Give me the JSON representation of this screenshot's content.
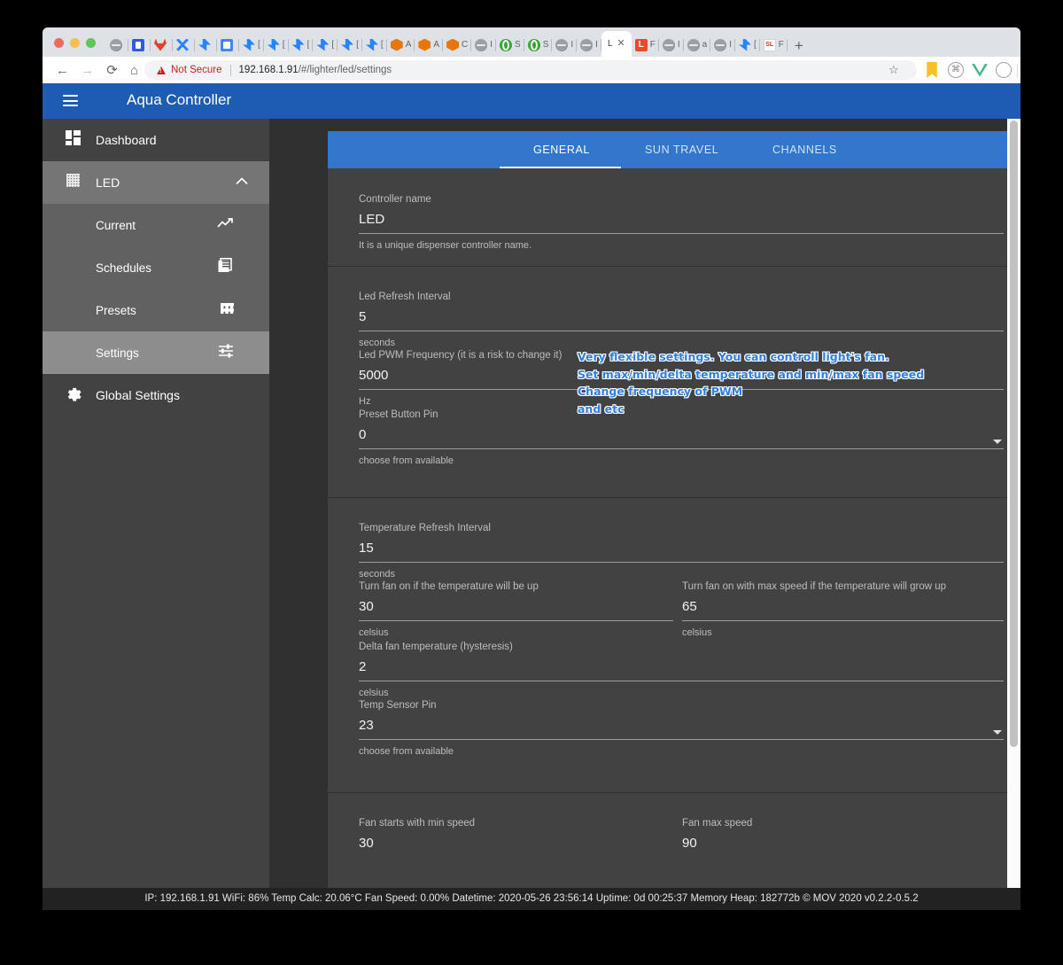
{
  "browser": {
    "url_prefix": "192.168.1.91",
    "url_rest": "/#/lighter/led/settings",
    "security_label": "Not Secure",
    "back_icon": "←",
    "forward_icon": "→",
    "reload_icon": "⟳",
    "home_icon": "⌂",
    "star_icon": "☆",
    "newtab_label": "+",
    "close_tab_label": "✕",
    "ext_cmd_glyph": "⌘",
    "ext_circ_glyph": "(..)",
    "profile_warning_glyph": "!",
    "tabs": [
      {
        "title": "",
        "favicon": "globe-icon",
        "active": false
      },
      {
        "title": "",
        "favicon": "blue-square-icon",
        "active": false
      },
      {
        "title": "",
        "favicon": "gitlab-icon",
        "active": false
      },
      {
        "title": "",
        "favicon": "x-icon",
        "active": false
      },
      {
        "title": "",
        "favicon": "jira-icon",
        "active": false
      },
      {
        "title": "",
        "favicon": "doc-icon",
        "active": false
      },
      {
        "title": "[",
        "favicon": "jira-icon",
        "active": false
      },
      {
        "title": "[",
        "favicon": "jira-icon",
        "active": false
      },
      {
        "title": "[",
        "favicon": "jira-icon",
        "active": false
      },
      {
        "title": "[",
        "favicon": "jira-icon",
        "active": false
      },
      {
        "title": "[",
        "favicon": "jira-icon",
        "active": false
      },
      {
        "title": "[",
        "favicon": "jira-icon",
        "active": false
      },
      {
        "title": "A",
        "favicon": "cube-icon",
        "active": false
      },
      {
        "title": "A",
        "favicon": "cube-icon",
        "active": false
      },
      {
        "title": "C",
        "favicon": "cube-icon",
        "active": false
      },
      {
        "title": "I",
        "favicon": "globe-icon",
        "active": false
      },
      {
        "title": "S",
        "favicon": "green-circle-icon",
        "active": false
      },
      {
        "title": "S",
        "favicon": "green-circle-icon",
        "active": false
      },
      {
        "title": "I",
        "favicon": "globe-icon",
        "active": false
      },
      {
        "title": "I",
        "favicon": "globe-icon",
        "active": false
      },
      {
        "title": "L",
        "favicon": "none",
        "active": true
      },
      {
        "title": "F",
        "favicon": "orange-l-icon",
        "active": false
      },
      {
        "title": "I",
        "favicon": "globe-icon",
        "active": false
      },
      {
        "title": "a",
        "favicon": "globe-icon",
        "active": false
      },
      {
        "title": "I",
        "favicon": "globe-icon",
        "active": false
      },
      {
        "title": "[",
        "favicon": "jira-icon",
        "active": false
      },
      {
        "title": "F",
        "favicon": "sl-icon",
        "active": false
      }
    ]
  },
  "app": {
    "title": "Aqua Controller",
    "menu_icon": "hamburger-icon"
  },
  "sidebar": {
    "items": [
      {
        "label": "Dashboard",
        "icon": "dashboard-icon",
        "selected": false
      },
      {
        "label": "LED",
        "icon": "grid-icon",
        "selected": true,
        "chevron": "˄"
      }
    ],
    "sub_items": [
      {
        "label": "Current",
        "icon": "trending-up-icon",
        "selected": false
      },
      {
        "label": "Schedules",
        "icon": "list-icon",
        "selected": false
      },
      {
        "label": "Presets",
        "icon": "apps-grid-icon",
        "selected": false
      },
      {
        "label": "Settings",
        "icon": "tune-icon",
        "selected": true
      }
    ],
    "global": {
      "label": "Global Settings",
      "icon": "gear-icon"
    }
  },
  "tabs": {
    "items": [
      {
        "label": "GENERAL",
        "active": true
      },
      {
        "label": "SUN TRAVEL",
        "active": false
      },
      {
        "label": "CHANNELS",
        "active": false
      }
    ]
  },
  "form": {
    "controller_name": {
      "label": "Controller name",
      "value": "LED",
      "hint": "It is a unique dispenser controller name."
    },
    "led_refresh_interval": {
      "label": "Led Refresh Interval",
      "value": "5",
      "hint": "seconds"
    },
    "led_pwm_frequency": {
      "label": "Led PWM Frequency (it is a risk to change it)",
      "value": "5000",
      "hint": "Hz"
    },
    "preset_button_pin": {
      "label": "Preset Button Pin",
      "value": "0",
      "hint": "choose from available"
    },
    "temperature_refresh_interval": {
      "label": "Temperature Refresh Interval",
      "value": "15",
      "hint": "seconds"
    },
    "fan_on_temp": {
      "label": "Turn fan on if the temperature will be up",
      "value": "30",
      "hint": "celsius"
    },
    "fan_max_temp": {
      "label": "Turn fan on with max speed if the temperature will grow up",
      "value": "65",
      "hint": "celsius"
    },
    "delta_fan_temp": {
      "label": "Delta fan temperature (hysteresis)",
      "value": "2",
      "hint": "celsius"
    },
    "temp_sensor_pin": {
      "label": "Temp Sensor Pin",
      "value": "23",
      "hint": "choose from available"
    },
    "fan_min_speed": {
      "label": "Fan starts with min speed",
      "value": "30"
    },
    "fan_max_speed": {
      "label": "Fan max speed",
      "value": "90"
    }
  },
  "annotation": {
    "text": "Very flexible settings. You can controll light's fan.\nSet max/min/delta temperature and min/max fan speed\nChange frequency of PWM\nand etc",
    "color": "#2f7fe0"
  },
  "statusbar": {
    "text": "IP: 192.168.1.91 WiFi: 86% Temp Calc: 20.06°C Fan Speed: 0.00% Datetime: 2020-05-26 23:56:14 Uptime: 0d 00:25:37 Memory Heap: 182772b © MOV 2020 v0.2.2-0.5.2"
  }
}
